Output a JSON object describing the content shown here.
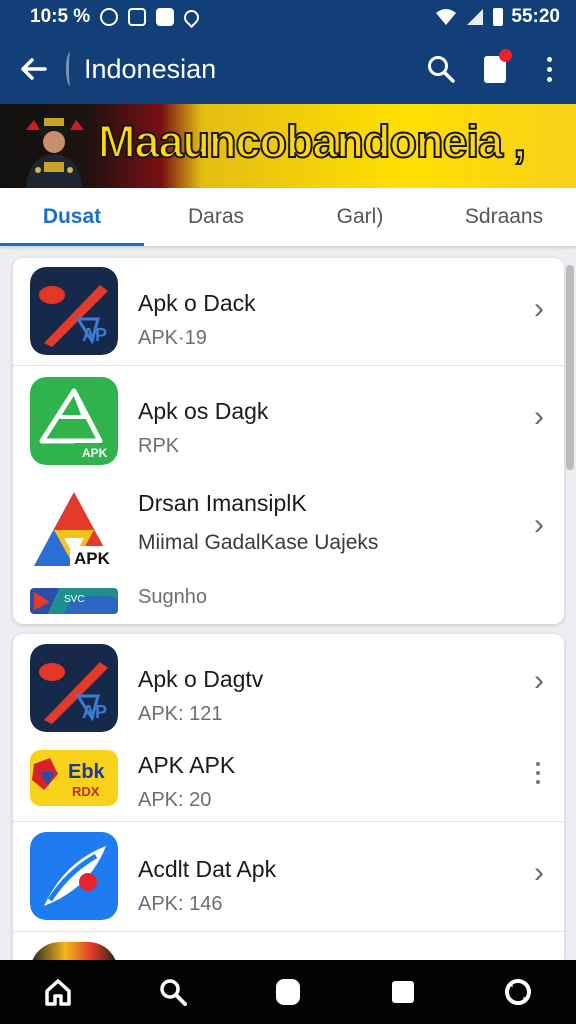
{
  "status_bar": {
    "time_left": "10:5 %",
    "time_right": "55:20"
  },
  "app_bar": {
    "title": "Indonesian"
  },
  "banner": {
    "text": "Maauncobandoneia ,"
  },
  "tabs": [
    {
      "label": "Dusat"
    },
    {
      "label": "Daras"
    },
    {
      "label": "Garl)"
    },
    {
      "label": "Sdraans"
    }
  ],
  "cards": [
    {
      "items": [
        {
          "title": "Apk o Dack",
          "subtitle": "APK·19",
          "icon": "rocket-apk-icon",
          "trailing": "chevron"
        },
        {
          "title": "Apk os Dagk",
          "subtitle": "RPK",
          "icon": "green-triangle-apk-icon",
          "trailing": "chevron"
        },
        {
          "title": "Drsan ImansiplK",
          "subtitle": "Miimal GadalKase Uajeks",
          "icon": "multicolor-triangle-apk-icon",
          "trailing": "chevron"
        },
        {
          "title": "",
          "subtitle": "Sugnho",
          "icon": "flag-strip-icon",
          "trailing": "none"
        }
      ]
    },
    {
      "items": [
        {
          "title": "Apk o Dagtv",
          "subtitle": "APK: 121",
          "icon": "rocket-apk-icon",
          "trailing": "chevron"
        },
        {
          "title": "APK APK",
          "subtitle": "APK: 20",
          "icon": "yellow-badge-icon",
          "trailing": "kebab"
        },
        {
          "title": "Acdlt Dat Apk",
          "subtitle": "APK: 146",
          "icon": "blue-rocket-icon",
          "trailing": "chevron"
        },
        {
          "title": "",
          "subtitle": "",
          "icon": "partial-app-icon",
          "trailing": "none"
        }
      ]
    }
  ],
  "icons": {
    "back": "arrow-left-icon",
    "search": "search-icon",
    "notifications": "notification-icon",
    "more": "more-vert-icon"
  },
  "bottom_nav": [
    {
      "icon": "home-icon"
    },
    {
      "icon": "search-icon"
    },
    {
      "icon": "rounded-square-icon"
    },
    {
      "icon": "square-icon"
    },
    {
      "icon": "refresh-icon"
    }
  ],
  "colors": {
    "app_bar": "#123f78",
    "accent": "#1a6fcf",
    "bottom_nav": "#040404"
  }
}
